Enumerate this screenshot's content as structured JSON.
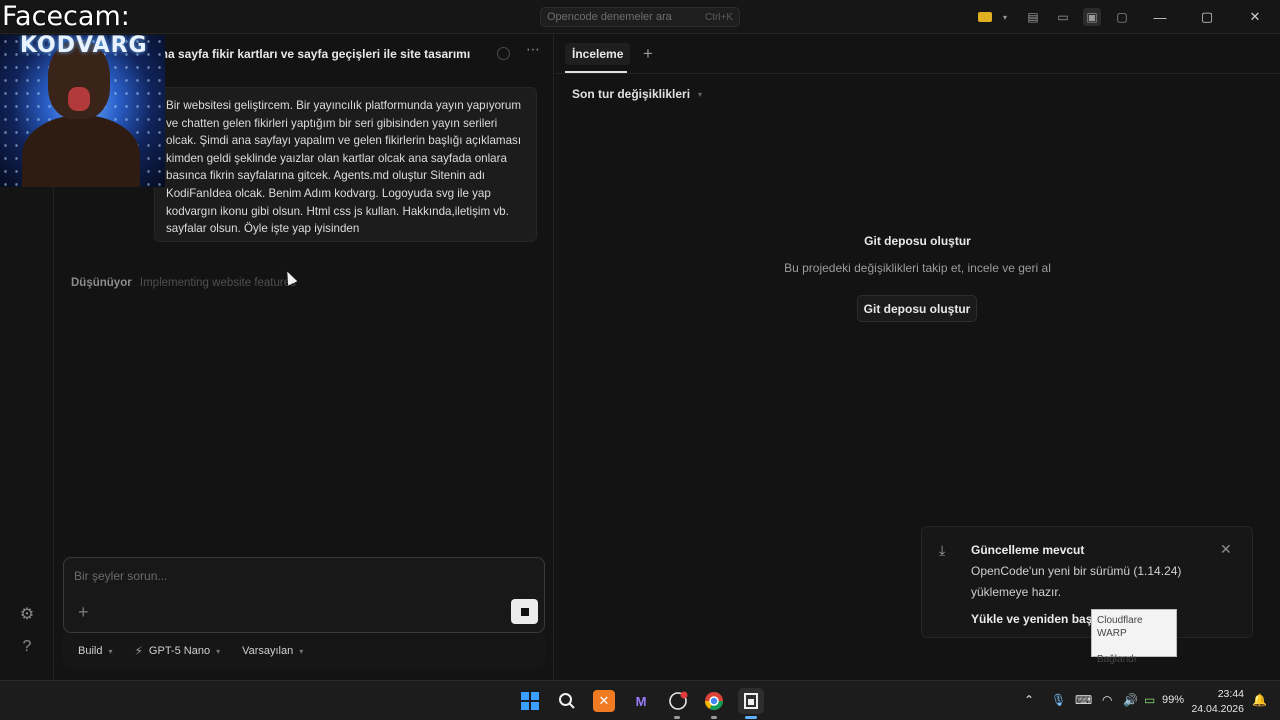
{
  "titlebar": {
    "search_placeholder": "Opencode denemeler ara",
    "search_shortcut": "Ctrl+K"
  },
  "chat": {
    "title": "ana sayfa fikir kartları ve sayfa geçişleri ile site tasarımı",
    "message": "Bir websitesi geliştircem. Bir yayıncılık platformunda yayın yapıyorum ve chatten gelen fikirleri yaptığım bir seri gibisinden yayın serileri olcak. Şimdi ana sayfayı yapalım ve gelen fikirlerin başlığı açıklaması kimden geldi şeklinde yaızlar olan kartlar olcak ana sayfada onlara basınca fikrin sayfalarına gitcek. Agents.md oluştur Sitenin adı KodiFanIdea olcak. Benim Adım kodvarg. Logoyuda svg ile yap kodvargın ikonu gibi olsun. Html css js kullan. Hakkında,iletişim vb. sayfalar olsun. Öyle işte yap iyisinden",
    "thinking_label": "Düşünüyor",
    "thinking_detail": "Implementing website features",
    "composer_placeholder": "Bir şeyler sorun...",
    "toolbar": {
      "agent": "Build",
      "model": "GPT-5 Nano",
      "variant": "Varsayılan"
    }
  },
  "review": {
    "tab_label": "İnceleme",
    "changes_label": "Son tur değişiklikleri",
    "empty_title": "Git deposu oluştur",
    "empty_subtitle": "Bu projedeki değişiklikleri takip et, incele ve geri al",
    "create_button": "Git deposu oluştur"
  },
  "toast": {
    "title": "Güncelleme mevcut",
    "body": "OpenCode'un yeni bir sürümü (1.14.24) yüklemeye hazır.",
    "action": "Yükle ve yeniden başlat"
  },
  "warp_tooltip": {
    "line1": "Cloudflare WARP",
    "line2": "Bağlandı"
  },
  "facecam": {
    "label": "Facecam:",
    "brand": "KODVARG"
  },
  "taskbar": {
    "battery": "99%",
    "time": "23:44",
    "date": "24.04.2026"
  }
}
